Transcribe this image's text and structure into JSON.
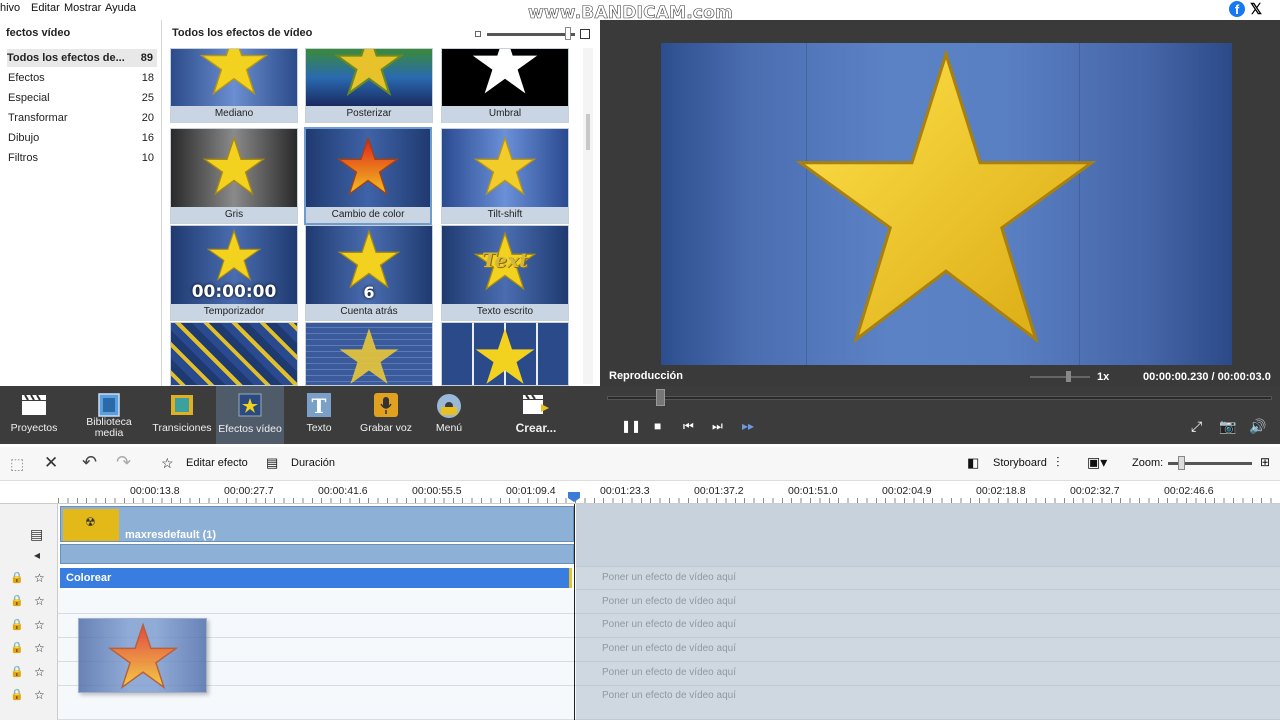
{
  "menubar": {
    "items": [
      "hivo",
      "Editar",
      "Mostrar",
      "Ayuda"
    ],
    "watermark": "www.BANDICAM.com"
  },
  "categories": {
    "header": "fectos vídeo",
    "items": [
      {
        "label": "Todos los efectos de...",
        "count": "89"
      },
      {
        "label": "Efectos",
        "count": "18"
      },
      {
        "label": "Especial",
        "count": "25"
      },
      {
        "label": "Transformar",
        "count": "20"
      },
      {
        "label": "Dibujo",
        "count": "16"
      },
      {
        "label": "Filtros",
        "count": "10"
      }
    ]
  },
  "gallery": {
    "header": "Todos los efectos de vídeo",
    "tiles": [
      {
        "label": "Mediano"
      },
      {
        "label": "Posterizar"
      },
      {
        "label": "Umbral"
      },
      {
        "label": "Gris"
      },
      {
        "label": "Cambio de color"
      },
      {
        "label": "Tilt-shift"
      },
      {
        "label": "Temporizador",
        "overlay": "00:00:00"
      },
      {
        "label": "Cuenta atrás",
        "overlay": "6"
      },
      {
        "label": "Texto escrito",
        "overlay": "Text"
      },
      {
        "label": ""
      },
      {
        "label": ""
      },
      {
        "label": ""
      }
    ]
  },
  "preview": {
    "label": "Reproducción",
    "speed": "1x",
    "time": "00:00:00.230  /  00:00:03.0"
  },
  "toolbar": {
    "buttons": [
      {
        "label": "Proyectos"
      },
      {
        "label": "Biblioteca media"
      },
      {
        "label": "Transiciones"
      },
      {
        "label": "Efectos vídeo"
      },
      {
        "label": "Texto"
      },
      {
        "label": "Grabar voz"
      },
      {
        "label": "Menú"
      },
      {
        "label": "Crear..."
      }
    ]
  },
  "timeline_toolbar": {
    "edit_effect": "Editar efecto",
    "duration": "Duración",
    "storyboard": "Storyboard",
    "zoom": "Zoom:"
  },
  "ruler": {
    "ticks": [
      "00:00:13.8",
      "00:00:27.7",
      "00:00:41.6",
      "00:00:55.5",
      "00:01:09.4",
      "00:01:23.3",
      "00:01:37.2",
      "00:01:51.0",
      "00:02:04.9",
      "00:02:18.8",
      "00:02:32.7",
      "00:02:46.6"
    ]
  },
  "tracks": {
    "clip_title": "maxresdefault (1)",
    "effect_clip": "Colorear",
    "placeholder": "Poner un efecto de vídeo aquí"
  },
  "colors": {
    "accent": "#3a7de0",
    "toolbar_bg": "#3c3c3c",
    "preview_bg": "#3a3a3a",
    "star": "#f2d21f"
  }
}
